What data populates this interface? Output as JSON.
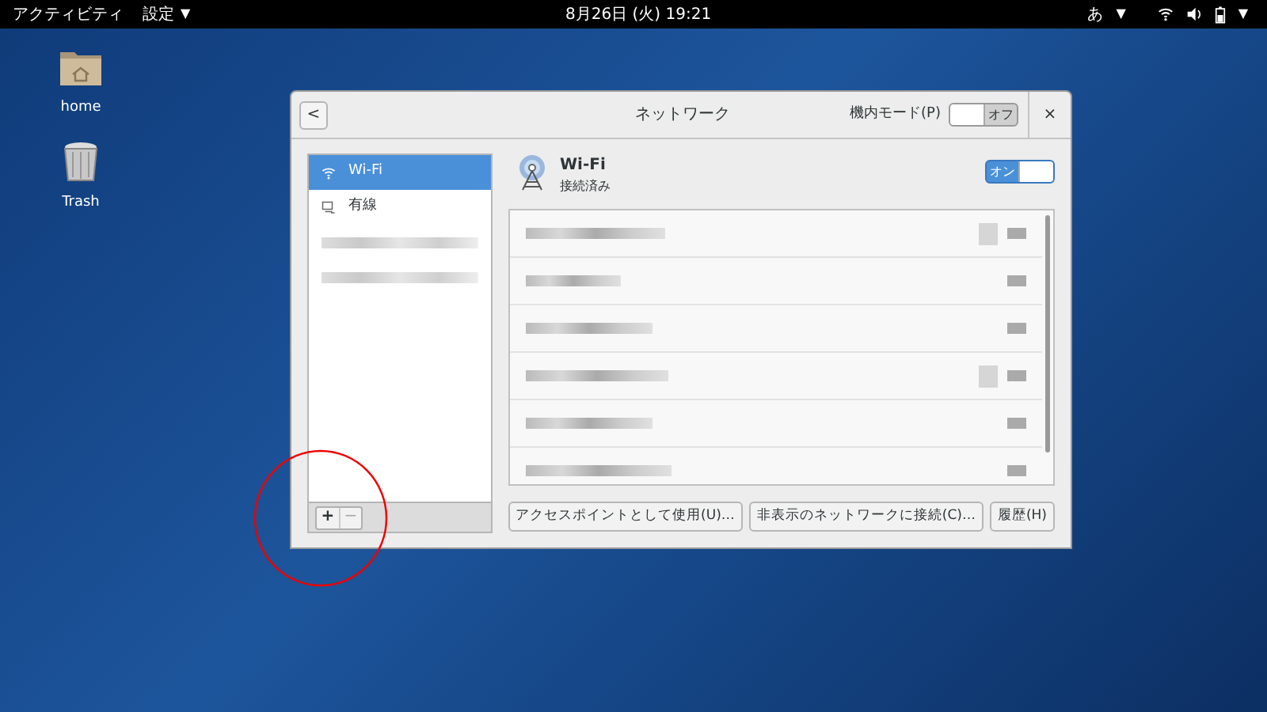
{
  "top_bar": {
    "activities": "アクティビティ",
    "app_menu": "設定",
    "app_menu_arrow": "▼",
    "clock": "8月26日 (火) 19:21",
    "input_method": "あ",
    "input_method_arrow": "▼",
    "system_arrow": "▼"
  },
  "desktop_icons": [
    {
      "kind": "folder",
      "label": "home"
    },
    {
      "kind": "trash",
      "label": "Trash"
    }
  ],
  "window": {
    "back": "<",
    "title": "ネットワーク",
    "airplane_mode": {
      "label": "機内モード(P)",
      "state_label": "オフ",
      "on": false
    },
    "close": "×"
  },
  "sidebar": {
    "items": [
      {
        "kind": "wifi",
        "label": "Wi-Fi",
        "selected": true
      },
      {
        "kind": "wired",
        "label": "有線",
        "selected": false
      },
      {
        "kind": "redacted",
        "selected": false
      },
      {
        "kind": "redacted",
        "selected": false
      }
    ],
    "add": "+",
    "remove": "−"
  },
  "wifi": {
    "title": "Wi-Fi",
    "status": "接続済み",
    "toggle": {
      "state_label": "オン",
      "on": true
    },
    "networks": [
      {
        "locked": true
      },
      {
        "locked": false
      },
      {
        "locked": false
      },
      {
        "locked": true
      },
      {
        "locked": false
      },
      {
        "locked": false
      }
    ],
    "buttons": [
      "アクセスポイントとして使用(U)…",
      "非表示のネットワークに接続(C)…",
      "履歴(H)"
    ]
  }
}
